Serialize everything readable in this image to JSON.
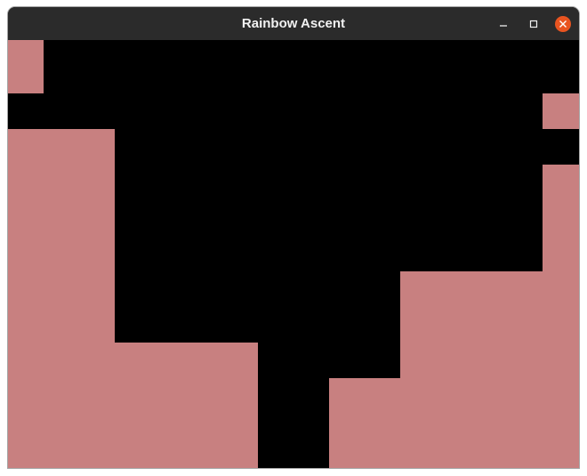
{
  "window": {
    "title": "Rainbow Ascent"
  },
  "controls": {
    "minimize_icon": "minimize-icon",
    "maximize_icon": "maximize-icon",
    "close_icon": "close-icon",
    "close_color": "#e95420"
  },
  "colors": {
    "background": "#000000",
    "terrain": "#c88080",
    "titlebar": "#2b2b2b"
  }
}
